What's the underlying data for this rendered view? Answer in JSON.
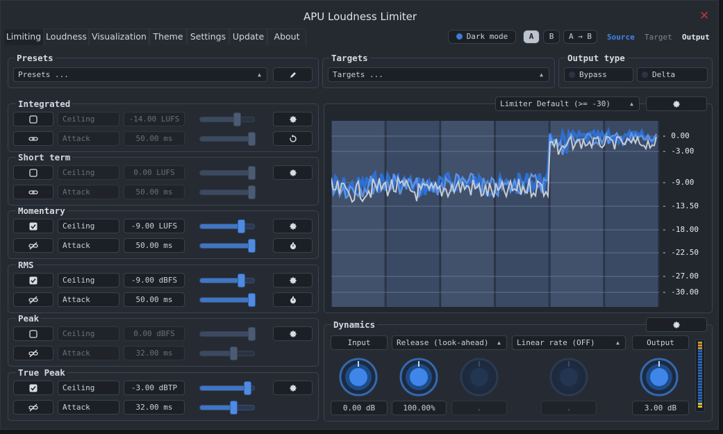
{
  "app": {
    "title": "APU Loudness Limiter"
  },
  "tabs": [
    "Limiting",
    "Loudness",
    "Visualization",
    "Theme",
    "Settings",
    "Update",
    "About"
  ],
  "header": {
    "dark_mode": "Dark mode",
    "ab": {
      "a": "A",
      "b": "B",
      "copy": "A → B"
    },
    "view": {
      "source": "Source",
      "target": "Target",
      "output": "Output"
    }
  },
  "presets": {
    "title": "Presets",
    "value": "Presets ..."
  },
  "targets": {
    "title": "Targets",
    "value": "Targets ..."
  },
  "output_type": {
    "title": "Output type",
    "bypass": "Bypass",
    "delta": "Delta"
  },
  "sections": [
    {
      "title": "Integrated",
      "enabled": false,
      "ceiling_label": "Ceiling",
      "ceiling": "-14.00 LUFS",
      "attack_label": "Attack",
      "attack": "50.00 ms",
      "ceiling_level": 0.7,
      "attack_level": 1.0
    },
    {
      "title": "Short term",
      "enabled": false,
      "ceiling_label": "Ceiling",
      "ceiling": "0.00 LUFS",
      "attack_label": "Attack",
      "attack": "50.00 ms",
      "ceiling_level": 1.0,
      "attack_level": 1.0
    },
    {
      "title": "Momentary",
      "enabled": true,
      "ceiling_label": "Ceiling",
      "ceiling": "-9.00 LUFS",
      "attack_label": "Attack",
      "attack": "50.00 ms",
      "ceiling_level": 0.78,
      "attack_level": 1.0
    },
    {
      "title": "RMS",
      "enabled": true,
      "ceiling_label": "Ceiling",
      "ceiling": "-9.00 dBFS",
      "attack_label": "Attack",
      "attack": "50.00 ms",
      "ceiling_level": 0.78,
      "attack_level": 1.0
    },
    {
      "title": "Peak",
      "enabled": false,
      "ceiling_label": "Ceiling",
      "ceiling": "0.00 dBFS",
      "attack_label": "Attack",
      "attack": "32.00 ms",
      "ceiling_level": 1.0,
      "attack_level": 0.62
    },
    {
      "title": "True Peak",
      "enabled": true,
      "ceiling_label": "Ceiling",
      "ceiling": "-3.00 dBTP",
      "attack_label": "Attack",
      "attack": "32.00 ms",
      "ceiling_level": 0.92,
      "attack_level": 0.62
    }
  ],
  "graph": {
    "mode": "Limiter Default (>= -30)",
    "scale": [
      "0.00",
      "-3.00",
      "-9.00",
      "-13.50",
      "-18.00",
      "-22.50",
      "-27.00",
      "-30.00"
    ]
  },
  "dynamics": {
    "title": "Dynamics",
    "input_label": "Input",
    "release": "Release (look-ahead)",
    "rate": "Linear rate (OFF)",
    "output_label": "Output",
    "input_value": "0.00 dB",
    "release_value": "100.00%",
    "knob3_value": ".",
    "knob4_value": ".",
    "output_value": "3.00 dB"
  },
  "colors": {
    "accent": "#3f7bd0",
    "close": "#c9303a"
  }
}
